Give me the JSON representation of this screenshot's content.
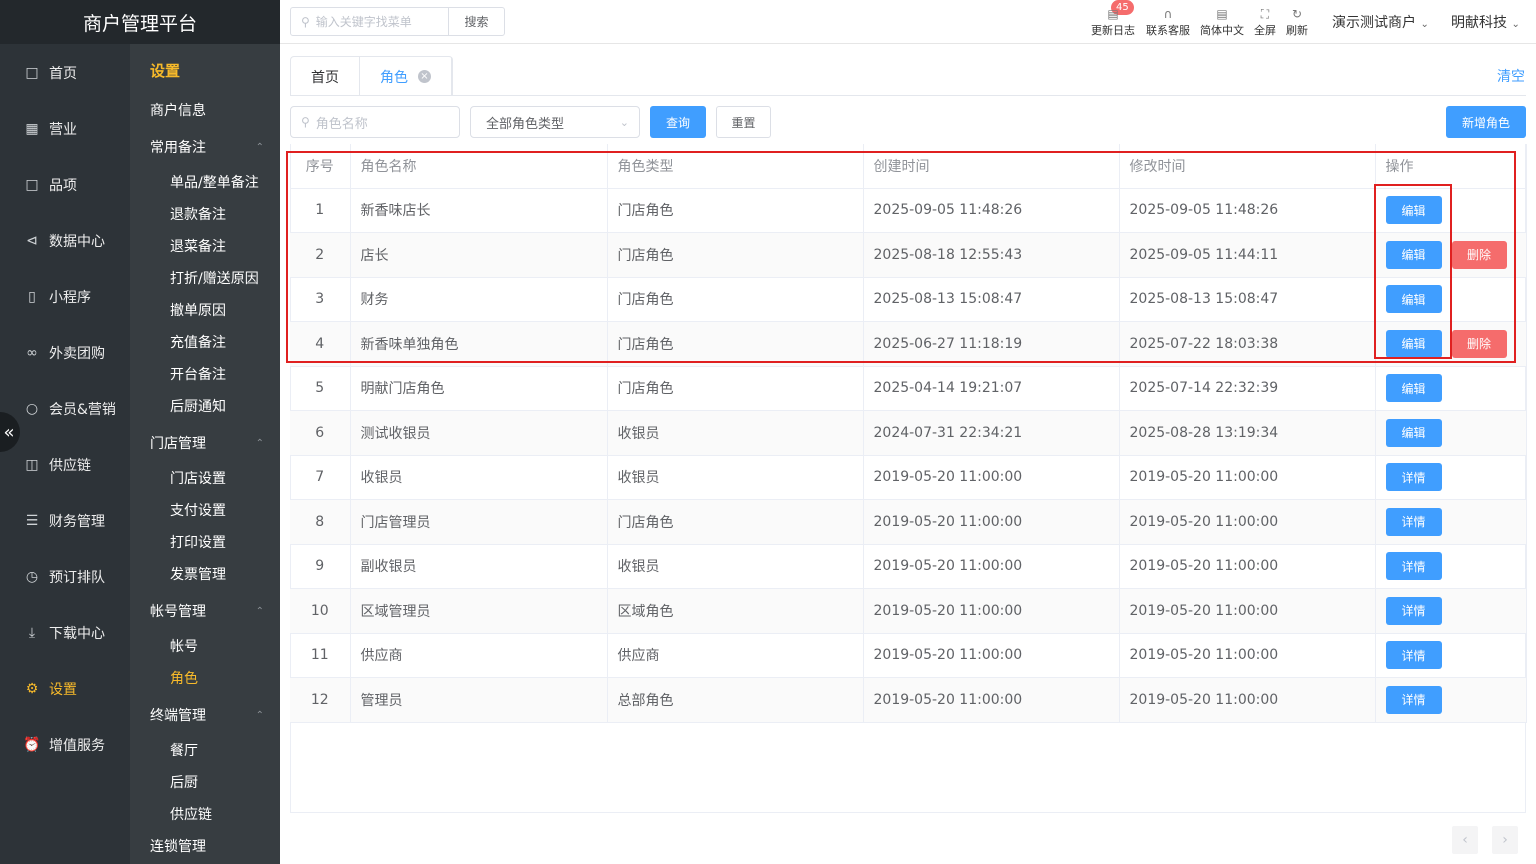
{
  "app": {
    "title": "商户管理平台",
    "collapse_icon": "«"
  },
  "sidebar": {
    "items": [
      {
        "label": "首页",
        "icon": "home-icon"
      },
      {
        "label": "营业",
        "icon": "calendar-icon"
      },
      {
        "label": "品项",
        "icon": "bag-icon"
      },
      {
        "label": "数据中心",
        "icon": "share-icon"
      },
      {
        "label": "小程序",
        "icon": "phone-icon"
      },
      {
        "label": "外卖团购",
        "icon": "bike-icon"
      },
      {
        "label": "会员&营销",
        "icon": "user-icon"
      },
      {
        "label": "供应链",
        "icon": "truck-icon"
      },
      {
        "label": "财务管理",
        "icon": "coins-icon"
      },
      {
        "label": "预订排队",
        "icon": "clock-icon"
      },
      {
        "label": "下载中心",
        "icon": "download-icon"
      },
      {
        "label": "设置",
        "icon": "gear-icon",
        "active": true
      },
      {
        "label": "增值服务",
        "icon": "alarm-icon"
      }
    ]
  },
  "submenu": {
    "title": "设置",
    "merchant_info": "商户信息",
    "groups": [
      {
        "label": "常用备注",
        "items": [
          "单品/整单备注",
          "退款备注",
          "退菜备注",
          "打折/赠送原因",
          "撤单原因",
          "充值备注",
          "开台备注",
          "后厨通知"
        ]
      },
      {
        "label": "门店管理",
        "items": [
          "门店设置",
          "支付设置",
          "打印设置",
          "发票管理"
        ]
      },
      {
        "label": "帐号管理",
        "items": [
          "帐号",
          "角色"
        ]
      },
      {
        "label": "终端管理",
        "items": [
          "餐厅",
          "后厨",
          "供应链"
        ]
      }
    ],
    "chain": "连锁管理",
    "active_item": "角色"
  },
  "topbar": {
    "search_placeholder": "输入关键字找菜单",
    "search_button": "搜索",
    "badge_count": "45",
    "actions": [
      {
        "label": "更新日志",
        "icon": "log-icon"
      },
      {
        "label": "联系客服",
        "icon": "headset-icon"
      },
      {
        "label": "简体中文",
        "icon": "translate-icon"
      },
      {
        "label": "全屏",
        "icon": "fullscreen-icon"
      },
      {
        "label": "刷新",
        "icon": "refresh-icon"
      }
    ],
    "merchant_select": "演示测试商户",
    "company_select": "明献科技"
  },
  "tabs": [
    {
      "label": "首页"
    },
    {
      "label": "角色",
      "active": true
    }
  ],
  "clear_all": "清空",
  "filters": {
    "name_placeholder": "角色名称",
    "type_value": "全部角色类型",
    "query_button": "查询",
    "reset_button": "重置",
    "add_button": "新增角色"
  },
  "table": {
    "headers": [
      "序号",
      "角色名称",
      "角色类型",
      "创建时间",
      "修改时间",
      "操作"
    ],
    "rows": [
      {
        "no": "1",
        "name": "新香味店长",
        "type": "门店角色",
        "created": "2025-09-05 11:48:26",
        "modified": "2025-09-05 11:48:26",
        "actions": [
          "编辑"
        ]
      },
      {
        "no": "2",
        "name": "店长",
        "type": "门店角色",
        "created": "2025-08-18 12:55:43",
        "modified": "2025-09-05 11:44:11",
        "actions": [
          "编辑",
          "删除"
        ]
      },
      {
        "no": "3",
        "name": "财务",
        "type": "门店角色",
        "created": "2025-08-13 15:08:47",
        "modified": "2025-08-13 15:08:47",
        "actions": [
          "编辑"
        ]
      },
      {
        "no": "4",
        "name": "新香味单独角色",
        "type": "门店角色",
        "created": "2025-06-27 11:18:19",
        "modified": "2025-07-22 18:03:38",
        "actions": [
          "编辑",
          "删除"
        ]
      },
      {
        "no": "5",
        "name": "明献门店角色",
        "type": "门店角色",
        "created": "2025-04-14 19:21:07",
        "modified": "2025-07-14 22:32:39",
        "actions": [
          "编辑"
        ]
      },
      {
        "no": "6",
        "name": "测试收银员",
        "type": "收银员",
        "created": "2024-07-31 22:34:21",
        "modified": "2025-08-28 13:19:34",
        "actions": [
          "编辑"
        ]
      },
      {
        "no": "7",
        "name": "收银员",
        "type": "收银员",
        "created": "2019-05-20 11:00:00",
        "modified": "2019-05-20 11:00:00",
        "actions": [
          "详情"
        ]
      },
      {
        "no": "8",
        "name": "门店管理员",
        "type": "门店角色",
        "created": "2019-05-20 11:00:00",
        "modified": "2019-05-20 11:00:00",
        "actions": [
          "详情"
        ]
      },
      {
        "no": "9",
        "name": "副收银员",
        "type": "收银员",
        "created": "2019-05-20 11:00:00",
        "modified": "2019-05-20 11:00:00",
        "actions": [
          "详情"
        ]
      },
      {
        "no": "10",
        "name": "区域管理员",
        "type": "区域角色",
        "created": "2019-05-20 11:00:00",
        "modified": "2019-05-20 11:00:00",
        "actions": [
          "详情"
        ]
      },
      {
        "no": "11",
        "name": "供应商",
        "type": "供应商",
        "created": "2019-05-20 11:00:00",
        "modified": "2019-05-20 11:00:00",
        "actions": [
          "详情"
        ]
      },
      {
        "no": "12",
        "name": "管理员",
        "type": "总部角色",
        "created": "2019-05-20 11:00:00",
        "modified": "2019-05-20 11:00:00",
        "actions": [
          "详情"
        ]
      }
    ]
  },
  "pagination": {
    "prev": "‹",
    "next": "›"
  },
  "colors": {
    "primary": "#409eff",
    "danger": "#f56c6c",
    "accent": "#f7ba2a",
    "highlight": "#e02020"
  }
}
